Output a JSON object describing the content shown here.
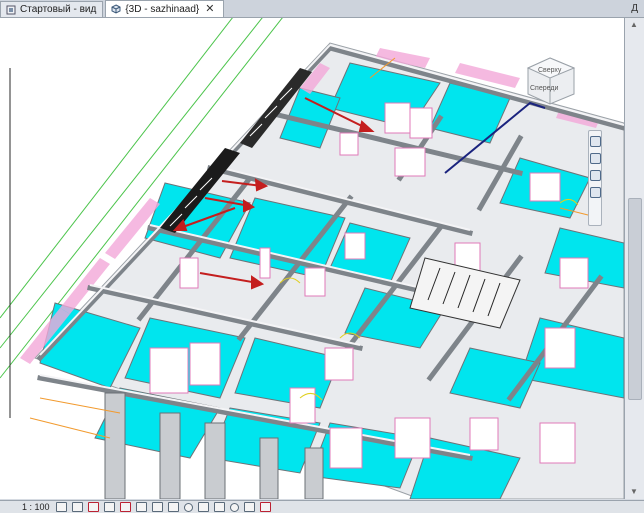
{
  "tabs": [
    {
      "label": "Стартовый - вид",
      "active": false,
      "icon": "home-view-icon"
    },
    {
      "label": "{3D - sazhinaad}",
      "active": true,
      "icon": "3d-view-icon",
      "close": "✕"
    }
  ],
  "tab_overflow": "Д",
  "viewcube": {
    "faces": [
      "Сверху",
      "Спереди"
    ],
    "icon": "viewcube-icon"
  },
  "statusbar": {
    "scale": "1 : 100",
    "icons": [
      "detail-level-icon",
      "visual-style-icon",
      "sun-path-icon",
      "shadows-icon",
      "render-icon",
      "crop-icon",
      "show-crop-icon",
      "lock-3d-icon",
      "temporary-hide-icon",
      "reveal-hidden-icon",
      "worksharing-icon",
      "analysis-icon",
      "highlight-icon",
      "constraints-icon"
    ]
  },
  "colors": {
    "floor": "#00e5ee",
    "wall": "#f4f4f6",
    "wall_shadow": "#8d939a",
    "accent_pink": "#f3a8d9",
    "annotation_arrow": "#c41e1e",
    "stair_dark": "#1a1a1a",
    "grid_green": "#3ac23a"
  }
}
